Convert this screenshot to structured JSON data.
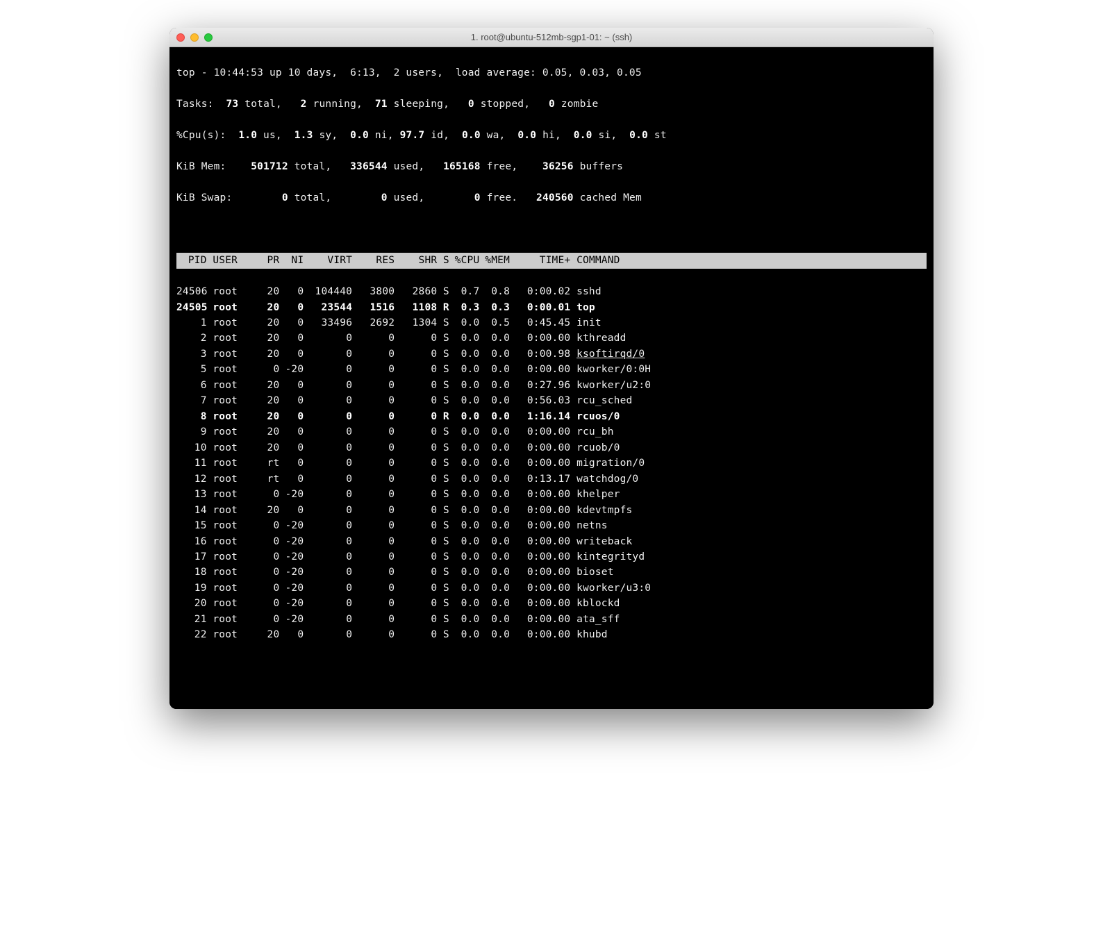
{
  "window": {
    "title": "1. root@ubuntu-512mb-sgp1-01: ~ (ssh)"
  },
  "summary": {
    "line1_prefix": "top - ",
    "time": "10:44:53",
    "up_text": " up 10 days,  6:13,  2 users,  load average: 0.05, 0.03, 0.05",
    "tasks_label": "Tasks:",
    "tasks_total": "73",
    "tasks_total_sfx": " total,",
    "tasks_running": "2",
    "tasks_running_sfx": " running,",
    "tasks_sleeping": "71",
    "tasks_sleeping_sfx": " sleeping,",
    "tasks_stopped": "0",
    "tasks_stopped_sfx": " stopped,",
    "tasks_zombie": "0",
    "tasks_zombie_sfx": " zombie",
    "cpu_label": "%Cpu(s):",
    "cpu_us": "1.0",
    "cpu_us_sfx": " us,",
    "cpu_sy": "1.3",
    "cpu_sy_sfx": " sy,",
    "cpu_ni": "0.0",
    "cpu_ni_sfx": " ni,",
    "cpu_id": "97.7",
    "cpu_id_sfx": " id,",
    "cpu_wa": "0.0",
    "cpu_wa_sfx": " wa,",
    "cpu_hi": "0.0",
    "cpu_hi_sfx": " hi,",
    "cpu_si": "0.0",
    "cpu_si_sfx": " si,",
    "cpu_st": "0.0",
    "cpu_st_sfx": " st",
    "mem_label": "KiB Mem:",
    "mem_total": "501712",
    "mem_total_sfx": " total,",
    "mem_used": "336544",
    "mem_used_sfx": " used,",
    "mem_free": "165168",
    "mem_free_sfx": " free,",
    "mem_buf": "36256",
    "mem_buf_sfx": " buffers",
    "swap_label": "KiB Swap:",
    "swap_total": "0",
    "swap_total_sfx": " total,",
    "swap_used": "0",
    "swap_used_sfx": " used,",
    "swap_free": "0",
    "swap_free_sfx": " free.",
    "swap_cached": "240560",
    "swap_cached_sfx": " cached Mem"
  },
  "columns": {
    "pid": "PID",
    "user": "USER",
    "pr": "PR",
    "ni": "NI",
    "virt": "VIRT",
    "res": "RES",
    "shr": "SHR",
    "s": "S",
    "cpu": "%CPU",
    "mem": "%MEM",
    "time": "TIME+",
    "cmd": "COMMAND"
  },
  "processes": [
    {
      "pid": "24506",
      "user": "root",
      "pr": "20",
      "ni": "0",
      "virt": "104440",
      "res": "3800",
      "shr": "2860",
      "s": "S",
      "cpu": "0.7",
      "mem": "0.8",
      "time": "0:00.02",
      "cmd": "sshd",
      "bold": false
    },
    {
      "pid": "24505",
      "user": "root",
      "pr": "20",
      "ni": "0",
      "virt": "23544",
      "res": "1516",
      "shr": "1108",
      "s": "R",
      "cpu": "0.3",
      "mem": "0.3",
      "time": "0:00.01",
      "cmd": "top",
      "bold": true
    },
    {
      "pid": "1",
      "user": "root",
      "pr": "20",
      "ni": "0",
      "virt": "33496",
      "res": "2692",
      "shr": "1304",
      "s": "S",
      "cpu": "0.0",
      "mem": "0.5",
      "time": "0:45.45",
      "cmd": "init",
      "bold": false
    },
    {
      "pid": "2",
      "user": "root",
      "pr": "20",
      "ni": "0",
      "virt": "0",
      "res": "0",
      "shr": "0",
      "s": "S",
      "cpu": "0.0",
      "mem": "0.0",
      "time": "0:00.00",
      "cmd": "kthreadd",
      "bold": false
    },
    {
      "pid": "3",
      "user": "root",
      "pr": "20",
      "ni": "0",
      "virt": "0",
      "res": "0",
      "shr": "0",
      "s": "S",
      "cpu": "0.0",
      "mem": "0.0",
      "time": "0:00.98",
      "cmd": "ksoftirqd/0",
      "bold": false,
      "underline": true
    },
    {
      "pid": "5",
      "user": "root",
      "pr": "0",
      "ni": "-20",
      "virt": "0",
      "res": "0",
      "shr": "0",
      "s": "S",
      "cpu": "0.0",
      "mem": "0.0",
      "time": "0:00.00",
      "cmd": "kworker/0:0H",
      "bold": false
    },
    {
      "pid": "6",
      "user": "root",
      "pr": "20",
      "ni": "0",
      "virt": "0",
      "res": "0",
      "shr": "0",
      "s": "S",
      "cpu": "0.0",
      "mem": "0.0",
      "time": "0:27.96",
      "cmd": "kworker/u2:0",
      "bold": false
    },
    {
      "pid": "7",
      "user": "root",
      "pr": "20",
      "ni": "0",
      "virt": "0",
      "res": "0",
      "shr": "0",
      "s": "S",
      "cpu": "0.0",
      "mem": "0.0",
      "time": "0:56.03",
      "cmd": "rcu_sched",
      "bold": false
    },
    {
      "pid": "8",
      "user": "root",
      "pr": "20",
      "ni": "0",
      "virt": "0",
      "res": "0",
      "shr": "0",
      "s": "R",
      "cpu": "0.0",
      "mem": "0.0",
      "time": "1:16.14",
      "cmd": "rcuos/0",
      "bold": true
    },
    {
      "pid": "9",
      "user": "root",
      "pr": "20",
      "ni": "0",
      "virt": "0",
      "res": "0",
      "shr": "0",
      "s": "S",
      "cpu": "0.0",
      "mem": "0.0",
      "time": "0:00.00",
      "cmd": "rcu_bh",
      "bold": false
    },
    {
      "pid": "10",
      "user": "root",
      "pr": "20",
      "ni": "0",
      "virt": "0",
      "res": "0",
      "shr": "0",
      "s": "S",
      "cpu": "0.0",
      "mem": "0.0",
      "time": "0:00.00",
      "cmd": "rcuob/0",
      "bold": false
    },
    {
      "pid": "11",
      "user": "root",
      "pr": "rt",
      "ni": "0",
      "virt": "0",
      "res": "0",
      "shr": "0",
      "s": "S",
      "cpu": "0.0",
      "mem": "0.0",
      "time": "0:00.00",
      "cmd": "migration/0",
      "bold": false
    },
    {
      "pid": "12",
      "user": "root",
      "pr": "rt",
      "ni": "0",
      "virt": "0",
      "res": "0",
      "shr": "0",
      "s": "S",
      "cpu": "0.0",
      "mem": "0.0",
      "time": "0:13.17",
      "cmd": "watchdog/0",
      "bold": false
    },
    {
      "pid": "13",
      "user": "root",
      "pr": "0",
      "ni": "-20",
      "virt": "0",
      "res": "0",
      "shr": "0",
      "s": "S",
      "cpu": "0.0",
      "mem": "0.0",
      "time": "0:00.00",
      "cmd": "khelper",
      "bold": false
    },
    {
      "pid": "14",
      "user": "root",
      "pr": "20",
      "ni": "0",
      "virt": "0",
      "res": "0",
      "shr": "0",
      "s": "S",
      "cpu": "0.0",
      "mem": "0.0",
      "time": "0:00.00",
      "cmd": "kdevtmpfs",
      "bold": false
    },
    {
      "pid": "15",
      "user": "root",
      "pr": "0",
      "ni": "-20",
      "virt": "0",
      "res": "0",
      "shr": "0",
      "s": "S",
      "cpu": "0.0",
      "mem": "0.0",
      "time": "0:00.00",
      "cmd": "netns",
      "bold": false
    },
    {
      "pid": "16",
      "user": "root",
      "pr": "0",
      "ni": "-20",
      "virt": "0",
      "res": "0",
      "shr": "0",
      "s": "S",
      "cpu": "0.0",
      "mem": "0.0",
      "time": "0:00.00",
      "cmd": "writeback",
      "bold": false
    },
    {
      "pid": "17",
      "user": "root",
      "pr": "0",
      "ni": "-20",
      "virt": "0",
      "res": "0",
      "shr": "0",
      "s": "S",
      "cpu": "0.0",
      "mem": "0.0",
      "time": "0:00.00",
      "cmd": "kintegrityd",
      "bold": false
    },
    {
      "pid": "18",
      "user": "root",
      "pr": "0",
      "ni": "-20",
      "virt": "0",
      "res": "0",
      "shr": "0",
      "s": "S",
      "cpu": "0.0",
      "mem": "0.0",
      "time": "0:00.00",
      "cmd": "bioset",
      "bold": false
    },
    {
      "pid": "19",
      "user": "root",
      "pr": "0",
      "ni": "-20",
      "virt": "0",
      "res": "0",
      "shr": "0",
      "s": "S",
      "cpu": "0.0",
      "mem": "0.0",
      "time": "0:00.00",
      "cmd": "kworker/u3:0",
      "bold": false
    },
    {
      "pid": "20",
      "user": "root",
      "pr": "0",
      "ni": "-20",
      "virt": "0",
      "res": "0",
      "shr": "0",
      "s": "S",
      "cpu": "0.0",
      "mem": "0.0",
      "time": "0:00.00",
      "cmd": "kblockd",
      "bold": false
    },
    {
      "pid": "21",
      "user": "root",
      "pr": "0",
      "ni": "-20",
      "virt": "0",
      "res": "0",
      "shr": "0",
      "s": "S",
      "cpu": "0.0",
      "mem": "0.0",
      "time": "0:00.00",
      "cmd": "ata_sff",
      "bold": false
    },
    {
      "pid": "22",
      "user": "root",
      "pr": "20",
      "ni": "0",
      "virt": "0",
      "res": "0",
      "shr": "0",
      "s": "S",
      "cpu": "0.0",
      "mem": "0.0",
      "time": "0:00.00",
      "cmd": "khubd",
      "bold": false
    }
  ]
}
